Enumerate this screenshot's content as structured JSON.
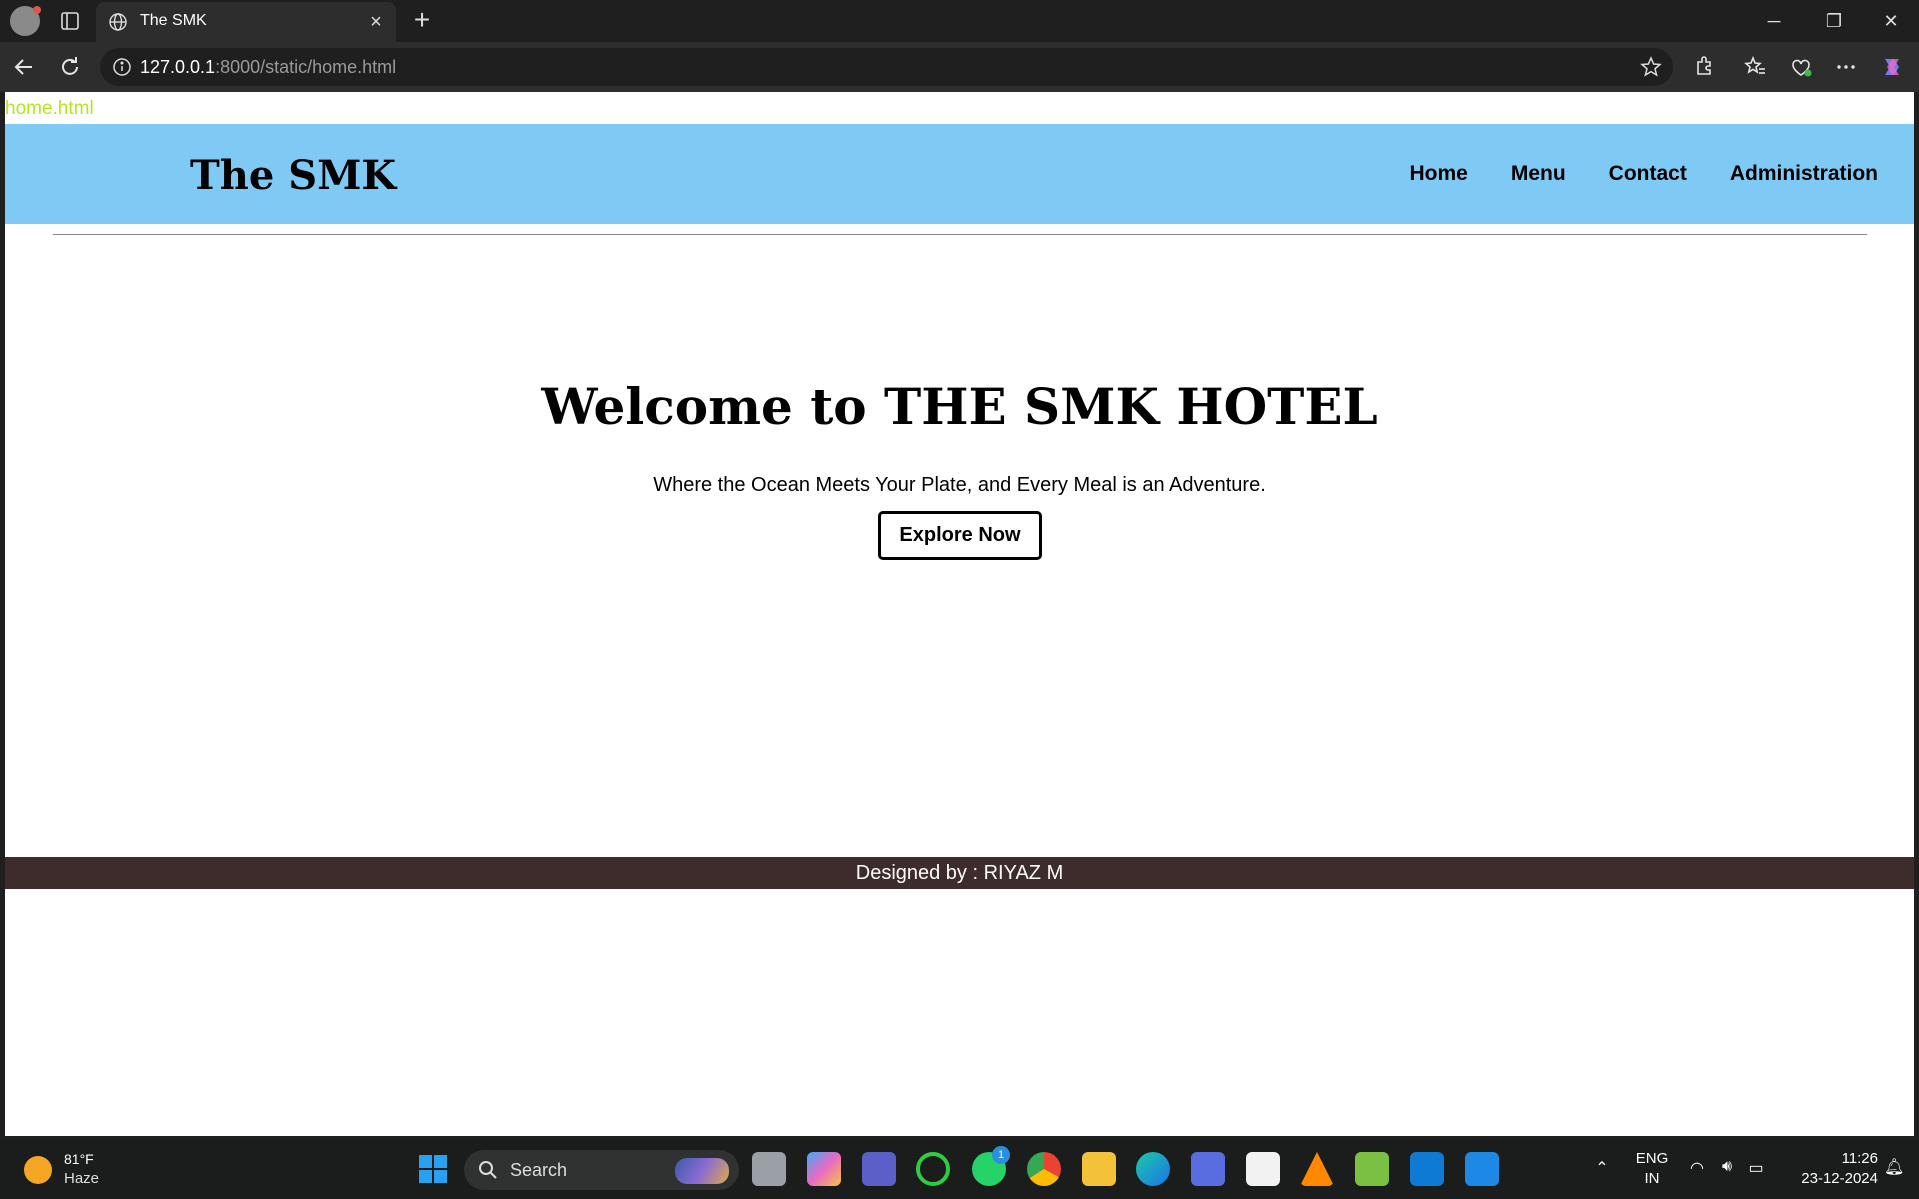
{
  "browser": {
    "tab_title": "The SMK",
    "url_host": "127.0.0.1",
    "url_rest": ":8000/static/home.html",
    "window_controls": [
      "minimize",
      "restore",
      "close"
    ]
  },
  "page": {
    "file_label": "home.html",
    "brand": "The SMK",
    "nav": [
      "Home",
      "Menu",
      "Contact",
      "Administration"
    ],
    "hero_title": "Welcome to THE SMK HOTEL",
    "hero_subtitle": "Where the Ocean Meets Your Plate, and Every Meal is an Adventure.",
    "cta_label": "Explore Now",
    "footer_text": "Designed by : RIYAZ M"
  },
  "taskbar": {
    "weather_temp": "81°F",
    "weather_condition": "Haze",
    "search_label": "Search",
    "whatsapp_badge": "1",
    "lang_top": "ENG",
    "lang_bottom": "IN",
    "time": "11:26",
    "date": "23-12-2024"
  },
  "colors": {
    "navbar_bg": "#7ecaf5",
    "footer_bg": "#3e2c2c",
    "file_label": "#b5e61d"
  }
}
